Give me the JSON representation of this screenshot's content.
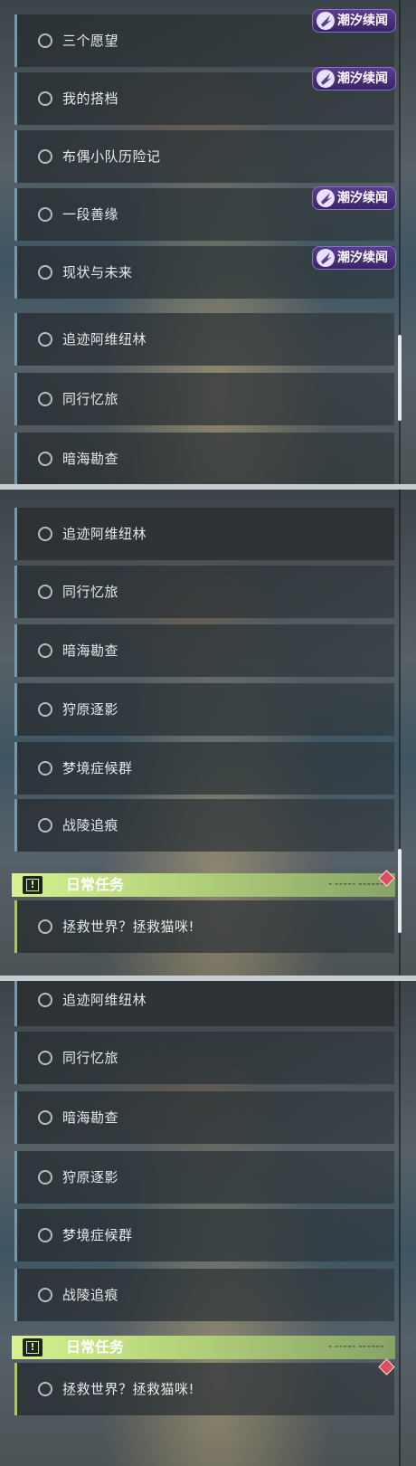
{
  "panel1": {
    "quests": [
      {
        "label": "三个愿望",
        "badge": true
      },
      {
        "label": "我的搭档",
        "badge": true
      },
      {
        "label": "布偶小队历险记",
        "badge": false
      },
      {
        "label": "一段善缘",
        "badge": true
      },
      {
        "label": "现状与未来",
        "badge": true
      },
      {
        "label": "追迹阿维纽林",
        "badge": false
      },
      {
        "label": "同行忆旅",
        "badge": false
      },
      {
        "label": "暗海勘查",
        "badge": false
      }
    ]
  },
  "panel2": {
    "quests": [
      {
        "label": "追迹阿维纽林"
      },
      {
        "label": "同行忆旅"
      },
      {
        "label": "暗海勘查"
      },
      {
        "label": "狩原逐影"
      },
      {
        "label": "梦境症候群"
      },
      {
        "label": "战陵追痕"
      }
    ],
    "daily_header": "日常任务",
    "daily_quest": "拯救世界？拯救猫咪!"
  },
  "panel3": {
    "quests": [
      {
        "label": "追迹阿维纽林"
      },
      {
        "label": "同行忆旅"
      },
      {
        "label": "暗海勘查"
      },
      {
        "label": "狩原逐影"
      },
      {
        "label": "梦境症候群"
      },
      {
        "label": "战陵追痕"
      }
    ],
    "daily_header": "日常任务",
    "daily_quest": "拯救世界？拯救猫咪!"
  },
  "badge_text": "潮汐续闻",
  "daily_icon": "!",
  "colors": {
    "badge_bg": "#4a2f7a",
    "daily_green": "#c4e383",
    "row_accent": "#7b96a6",
    "diamond_red": "#d9505e"
  }
}
